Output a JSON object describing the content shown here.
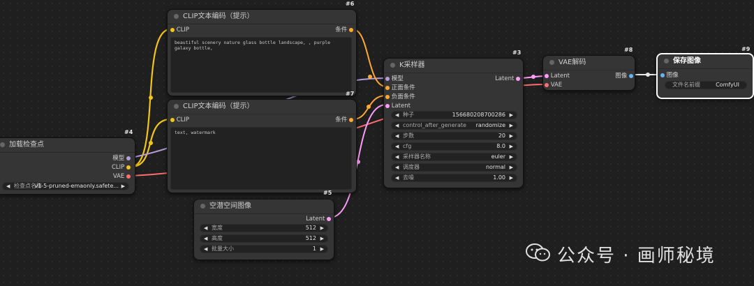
{
  "nodes": {
    "checkpoint": {
      "id": "#4",
      "title": "加载检查点",
      "out_model": "模型",
      "out_clip": "CLIP",
      "out_vae": "VAE",
      "w_label": "检查点名称",
      "w_value": "v1-5-pruned-emaonly.safete..."
    },
    "clip_pos": {
      "id": "#6",
      "title": "CLIP文本编码（提示）",
      "in_clip": "CLIP",
      "out_cond": "条件",
      "text": "beautiful scenery nature glass bottle landscape, , purple galaxy bottle,"
    },
    "clip_neg": {
      "id": "#7",
      "title": "CLIP文本编码（提示）",
      "in_clip": "CLIP",
      "out_cond": "条件",
      "text": "text, watermark"
    },
    "latent": {
      "id": "#5",
      "title": "空潜空间图像",
      "out_latent": "Latent",
      "widgets": [
        {
          "label": "宽度",
          "value": "512"
        },
        {
          "label": "高度",
          "value": "512"
        },
        {
          "label": "批量大小",
          "value": "1"
        }
      ]
    },
    "ksampler": {
      "id": "#3",
      "title": "K采样器",
      "in_model": "模型",
      "in_pos": "正面条件",
      "in_neg": "负面条件",
      "in_latent": "Latent",
      "out_latent": "Latent",
      "widgets": [
        {
          "label": "种子",
          "value": "156680208700286"
        },
        {
          "label": "control_after_generate",
          "value": "randomize"
        },
        {
          "label": "步数",
          "value": "20"
        },
        {
          "label": "cfg",
          "value": "8.0"
        },
        {
          "label": "采样器名称",
          "value": "euler"
        },
        {
          "label": "调度器",
          "value": "normal"
        },
        {
          "label": "去噪",
          "value": "1.00"
        }
      ]
    },
    "vae_decode": {
      "id": "#8",
      "title": "VAE解码",
      "in_latent": "Latent",
      "in_vae": "VAE",
      "out_image": "图像"
    },
    "save": {
      "id": "#9",
      "title": "保存图像",
      "in_image": "图像",
      "w_label": "文件名前缀",
      "w_value": "ComfyUI"
    }
  },
  "colors": {
    "clip": "#f2c518",
    "model": "#b39ddb",
    "vae": "#ff6e6e",
    "cond": "#ffa931",
    "latent": "#ff9cf9",
    "image": "#64b5f6"
  },
  "watermark": {
    "text": "公众号 · 画师秘境",
    "icon": "wechat-icon"
  }
}
